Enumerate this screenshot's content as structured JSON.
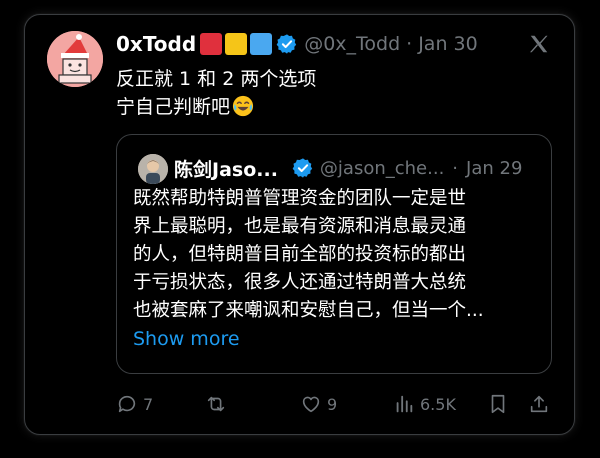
{
  "tweet": {
    "display_name": "0xTodd",
    "badges_colors": [
      "#e0303d",
      "#f5c518",
      "#4aa8f0"
    ],
    "verified_icon": "verified-badge-icon",
    "handle": "@0x_Todd",
    "dot": "·",
    "date": "Jan 30",
    "text_lines": [
      "反正就 1 和 2 两个选项",
      "宁自己判断吧"
    ],
    "emoji": "laughing-crying-emoji"
  },
  "quote": {
    "display_name": "陈剑Jaso...",
    "handle": "@jason_che...",
    "dot": "·",
    "date": "Jan 29",
    "text_lines": [
      "既然帮助特朗普管理资金的团队一定是世",
      "界上最聪明，也是最有资源和消息最灵通",
      "的人，但特朗普目前全部的投资标的都出",
      "于亏损状态，很多人还通过特朗普大总统",
      "也被套麻了来嘲讽和安慰自己，但当一个..."
    ],
    "show_more": "Show more"
  },
  "actions": {
    "reply_count": "7",
    "retweet_count": "",
    "like_count": "9",
    "views_count": "6.5K"
  },
  "colors": {
    "background": "#000000",
    "text": "#ffffff",
    "muted": "#71767b",
    "accent": "#1d9bf0"
  }
}
